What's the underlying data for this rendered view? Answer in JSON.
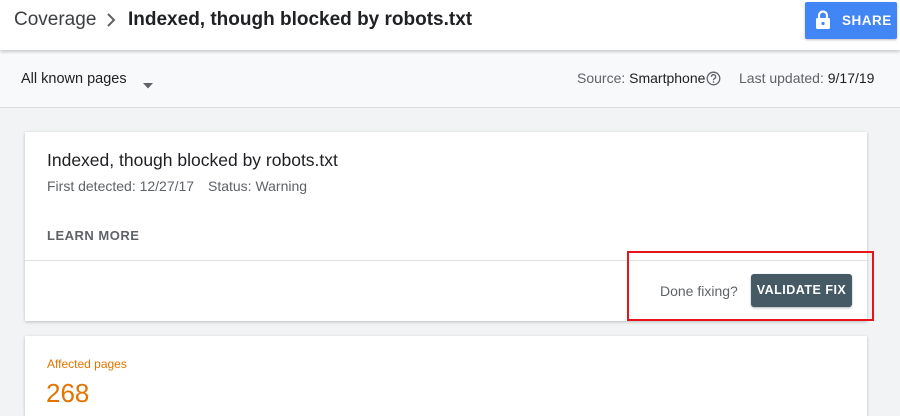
{
  "header": {
    "breadcrumb_root": "Coverage",
    "breadcrumb_separator_icon": "chevron-right-icon",
    "title": "Indexed, though blocked by robots.txt",
    "share_button": {
      "label": "SHARE",
      "icon": "lock-icon"
    }
  },
  "filter_bar": {
    "scope_select": {
      "value": "All known pages",
      "icon": "caret-down-icon"
    },
    "source_label": "Source:",
    "source_value": "Smartphone",
    "help_icon": "help-circle-icon",
    "updated_label": "Last updated:",
    "updated_value": "9/17/19"
  },
  "issue_card": {
    "title": "Indexed, though blocked by robots.txt",
    "first_detected": "First detected: 12/27/17",
    "status": "Status: Warning",
    "learn_more": "LEARN MORE",
    "done_fixing": "Done fixing?",
    "validate_button": "VALIDATE FIX"
  },
  "affected_card": {
    "label": "Affected pages",
    "value": "268"
  },
  "colors": {
    "share_button": "#4285f4",
    "validate_button": "#455a64",
    "affected_accent": "#e37400",
    "annotation_box": "#e8141b"
  }
}
